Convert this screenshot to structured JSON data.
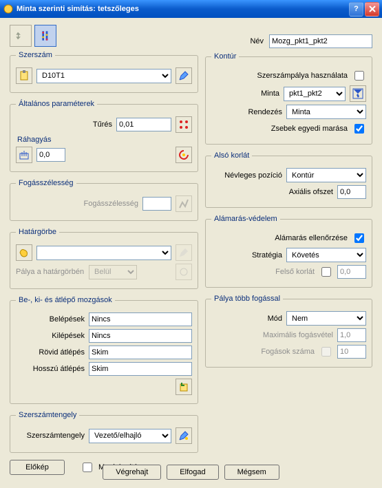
{
  "window": {
    "title": "Minta szerinti simítás: tetszőleges"
  },
  "top": {
    "name_label": "Név",
    "name_value": "Mozg_pkt1_pkt2"
  },
  "tool": {
    "legend": "Szerszám",
    "value": "D10T1"
  },
  "general": {
    "legend": "Általános paraméterek",
    "tolerance_label": "Tűrés",
    "tolerance_value": "0,01",
    "allowance_label": "Ráhagyás",
    "allowance_value": "0,0"
  },
  "cutwidth": {
    "legend": "Fogásszélesség",
    "label": "Fogásszélesség"
  },
  "boundary": {
    "legend": "Határgörbe",
    "path_label": "Pálya a határgörbén",
    "path_value": "Belül"
  },
  "moves": {
    "legend": "Be-, ki- és átlépő mozgások",
    "in_label": "Belépések",
    "in_value": "Nincs",
    "out_label": "Kilépések",
    "out_value": "Nincs",
    "short_label": "Rövid átlépés",
    "short_value": "Skim",
    "long_label": "Hosszú átlépés",
    "long_value": "Skim"
  },
  "axis": {
    "legend": "Szerszámtengely",
    "label": "Szerszámtengely",
    "value": "Vezető/elhajló"
  },
  "contour": {
    "legend": "Kontúr",
    "use_label": "Szerszámpálya használata",
    "pattern_label": "Minta",
    "pattern_value": "pkt1_pkt2",
    "order_label": "Rendezés",
    "order_value": "Minta",
    "pocket_label": "Zsebek egyedi marása"
  },
  "lower": {
    "legend": "Alsó korlát",
    "nominal_label": "Névleges pozíció",
    "nominal_value": "Kontúr",
    "axial_label": "Axiális ofszet",
    "axial_value": "0,0"
  },
  "gouge": {
    "legend": "Alámarás-védelem",
    "check_label": "Alámarás ellenőrzése",
    "strategy_label": "Stratégia",
    "strategy_value": "Követés",
    "upper_label": "Felső korlát",
    "upper_value": "0,0"
  },
  "multipass": {
    "legend": "Pálya több fogással",
    "mode_label": "Mód",
    "mode_value": "Nem",
    "max_label": "Maximális fogásvétel",
    "max_value": "1,0",
    "count_label": "Fogások száma",
    "count_value": "10"
  },
  "footer": {
    "preview": "Előkép",
    "display": "Megjelenítés",
    "execute": "Végrehajt",
    "accept": "Elfogad",
    "cancel": "Mégsem"
  }
}
